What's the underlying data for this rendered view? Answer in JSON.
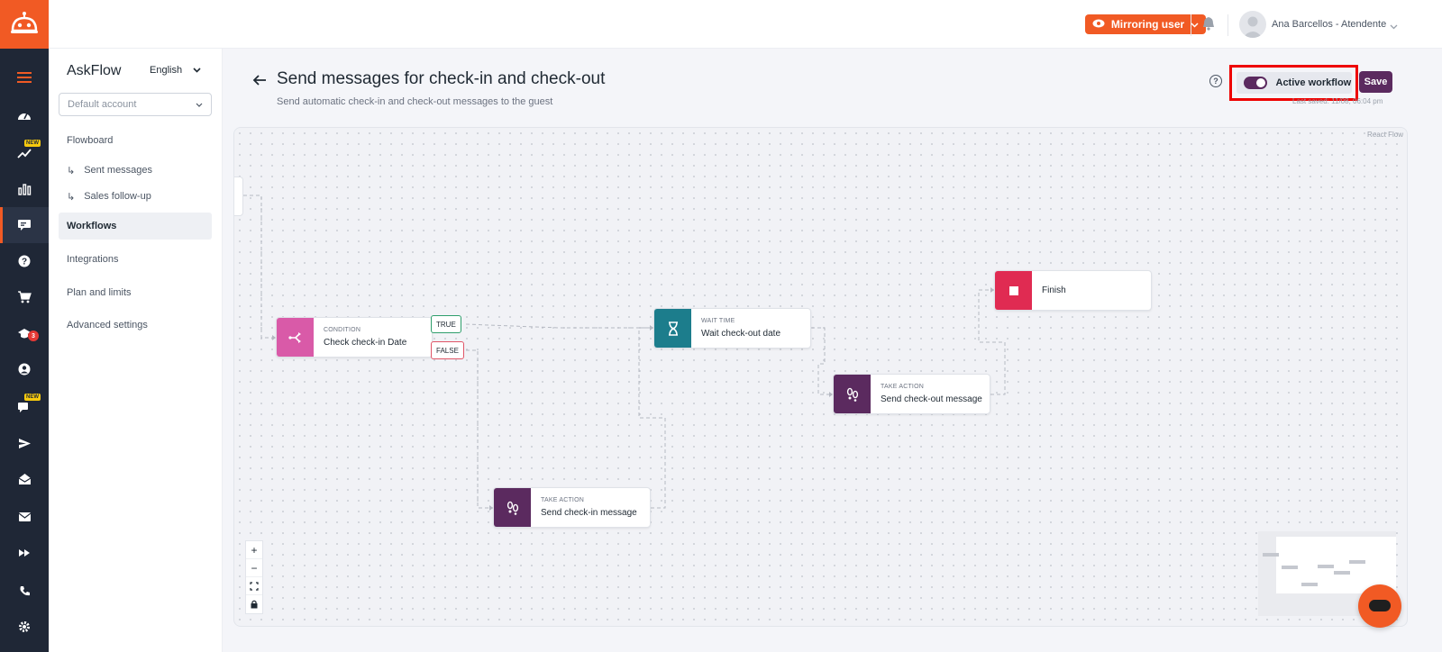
{
  "topbar": {
    "mirror_label": "Mirroring user",
    "user_name": "Ana Barcellos - Atendente"
  },
  "rail": {
    "badge_new": "NEW",
    "badge_count": "3",
    "icons": [
      "menu-icon",
      "dashboard-icon",
      "trending-icon",
      "bar-chart-icon",
      "chat-flow-icon",
      "help-icon",
      "cart-icon",
      "graduation-icon",
      "account-icon",
      "comments-icon",
      "send-icon",
      "inbox-icon",
      "mail-icon",
      "fast-forward-icon",
      "phone-icon",
      "settings-icon"
    ]
  },
  "sidebar": {
    "title": "AskFlow",
    "language": "English",
    "account_placeholder": "Default account",
    "items": [
      {
        "label": "Flowboard"
      },
      {
        "label": "Sent messages"
      },
      {
        "label": "Sales follow-up"
      },
      {
        "label": "Workflows"
      },
      {
        "label": "Integrations"
      },
      {
        "label": "Plan and limits"
      },
      {
        "label": "Advanced settings"
      }
    ]
  },
  "header": {
    "title": "Send messages for check-in and check-out",
    "subtitle": "Send automatic check-in and check-out messages to the guest",
    "active_label": "Active workflow",
    "save_label": "Save",
    "last_saved": "Last saved: 11/08, 06:04 pm"
  },
  "canvas": {
    "attribution": "React Flow",
    "nodes": [
      {
        "kind": "CONDITION",
        "label": "Check check-in Date",
        "color": "#d95aa8"
      },
      {
        "kind": "WAIT TIME",
        "label": "Wait check-out date",
        "color": "#1c7d8c"
      },
      {
        "kind": "",
        "label": "Finish",
        "color": "#e02b52"
      },
      {
        "kind": "TAKE ACTION",
        "label": "Send check-out message",
        "color": "#5b2a5f"
      },
      {
        "kind": "TAKE ACTION",
        "label": "Send check-in message",
        "color": "#5b2a5f"
      }
    ],
    "pills": {
      "true": "TRUE",
      "false": "FALSE"
    },
    "controls": [
      "+",
      "−"
    ]
  },
  "colors": {
    "brand": "#f15a24",
    "primary": "#5b2a5f",
    "rail": "#1f2736"
  }
}
